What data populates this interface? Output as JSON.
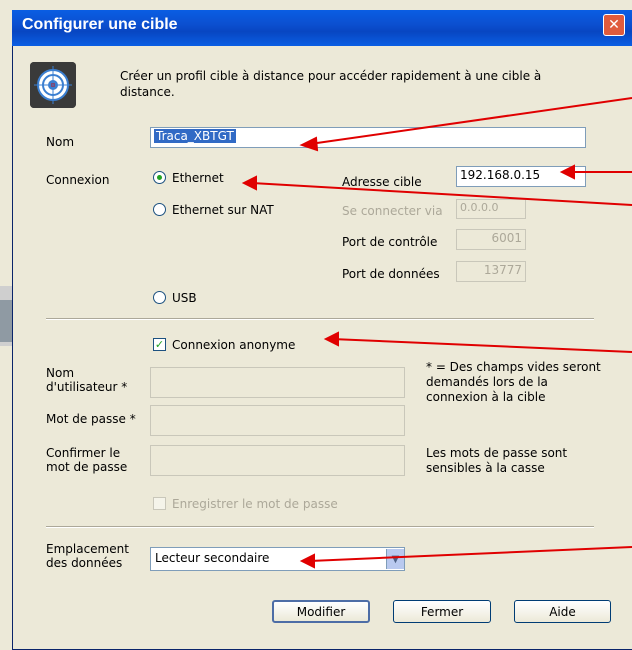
{
  "dialog": {
    "title": "Configurer une cible",
    "close_glyph": "✕",
    "description": "Créer un profil cible à distance pour accéder rapidement à une cible à distance."
  },
  "fields": {
    "name_label": "Nom",
    "name_value": "Traca_XBTGT",
    "connection_label": "Connexion",
    "radio_ethernet": "Ethernet",
    "radio_ethernet_nat": "Ethernet sur NAT",
    "radio_usb": "USB",
    "target_address_label": "Adresse cible",
    "target_address_value": "192.168.0.15",
    "connect_via_label": "Se connecter via",
    "connect_via_value": "0.0.0.0",
    "control_port_label": "Port de contrôle",
    "control_port_value": "6001",
    "data_port_label": "Port de données",
    "data_port_value": "13777"
  },
  "auth": {
    "anonymous_label": "Connexion anonyme",
    "anonymous_checked": true,
    "username_label_1": "Nom",
    "username_label_2": "d'utilisateur *",
    "password_label": "Mot de passe *",
    "confirm_label_1": "Confirmer le",
    "confirm_label_2": "mot de passe",
    "note_empty_1": "* = Des champs vides seront",
    "note_empty_2": "demandés lors de la",
    "note_empty_3": "connexion à la cible",
    "note_case_1": "Les mots de passe sont",
    "note_case_2": "sensibles à la casse",
    "save_password_label": "Enregistrer le mot de passe"
  },
  "storage": {
    "label_1": "Emplacement",
    "label_2": "des données",
    "selected": "Lecteur secondaire"
  },
  "buttons": {
    "modify": "Modifier",
    "close": "Fermer",
    "help": "Aide"
  },
  "colors": {
    "annotation_arrow": "#e00000",
    "titlebar": "#0a5ee3",
    "radio_dot": "#21a121"
  },
  "icons": {
    "dialog_icon": "target-icon",
    "close": "close-icon",
    "dropdown": "chevron-down-icon"
  }
}
